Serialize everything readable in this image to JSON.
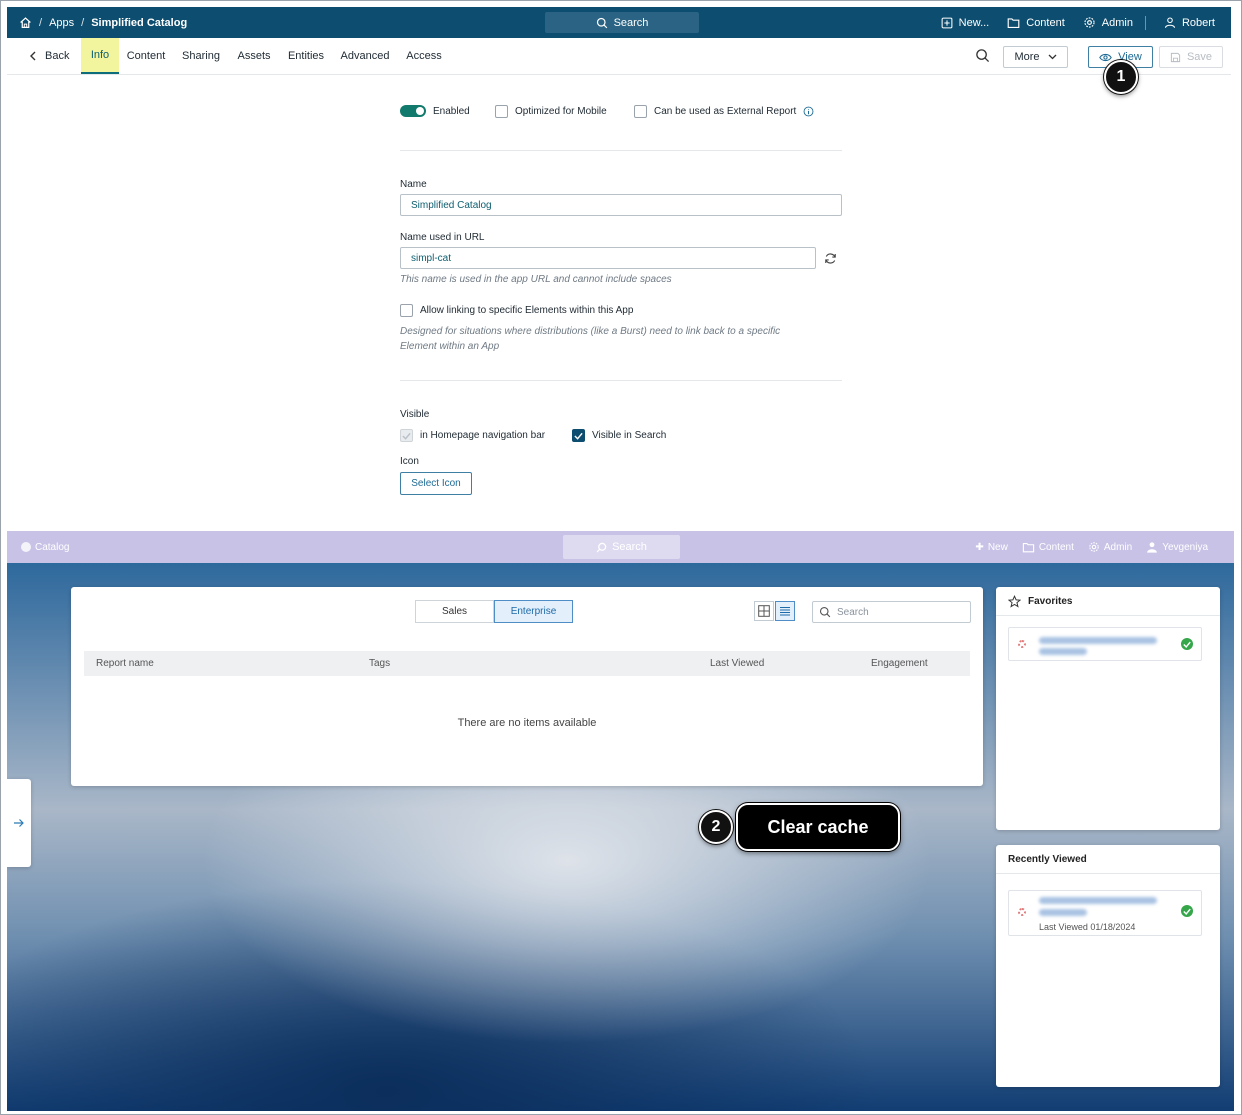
{
  "topbar": {
    "breadcrumb": [
      "Apps",
      "Simplified Catalog"
    ],
    "search_label": "Search",
    "new_label": "New...",
    "content_label": "Content",
    "admin_label": "Admin",
    "user_label": "Robert",
    "bg_color": "#0d4d6f"
  },
  "tabbar": {
    "back_label": "Back",
    "tabs": [
      "Info",
      "Content",
      "Sharing",
      "Assets",
      "Entities",
      "Advanced",
      "Access"
    ],
    "active_tab": "Info",
    "more_label": "More",
    "view_label": "View",
    "save_label": "Save"
  },
  "form": {
    "enabled_label": "Enabled",
    "optimized_label": "Optimized for Mobile",
    "external_label": "Can be used as External Report",
    "name_label": "Name",
    "name_value": "Simplified Catalog",
    "url_label": "Name used in URL",
    "url_value": "simpl-cat",
    "url_hint": "This name is used in the app URL and cannot include spaces",
    "allow_link_label": "Allow linking to specific Elements within this App",
    "allow_link_hint": "Designed for situations where distributions (like a Burst) need to link back to a specific Element within an App",
    "visible_label": "Visible",
    "homepage_nav_label": "in Homepage navigation bar",
    "visible_search_label": "Visible in Search",
    "icon_label": "Icon",
    "select_icon_label": "Select Icon"
  },
  "preview": {
    "logo_label": "Catalog",
    "search_label": "Search",
    "new_label": "New",
    "content_label": "Content",
    "admin_label": "Admin",
    "user_label": "Yevgeniya",
    "segments": [
      "Sales",
      "Enterprise"
    ],
    "active_segment": "Enterprise",
    "search_placeholder": "Search",
    "columns": [
      "Report name",
      "Tags",
      "Last Viewed",
      "Engagement"
    ],
    "empty_text": "There are no items available",
    "favorites_title": "Favorites",
    "recent_title": "Recently Viewed",
    "recent_last_viewed": "Last Viewed 01/18/2024"
  },
  "annotations": {
    "step1": "1",
    "step2": "2",
    "callout_text": "Clear cache"
  }
}
